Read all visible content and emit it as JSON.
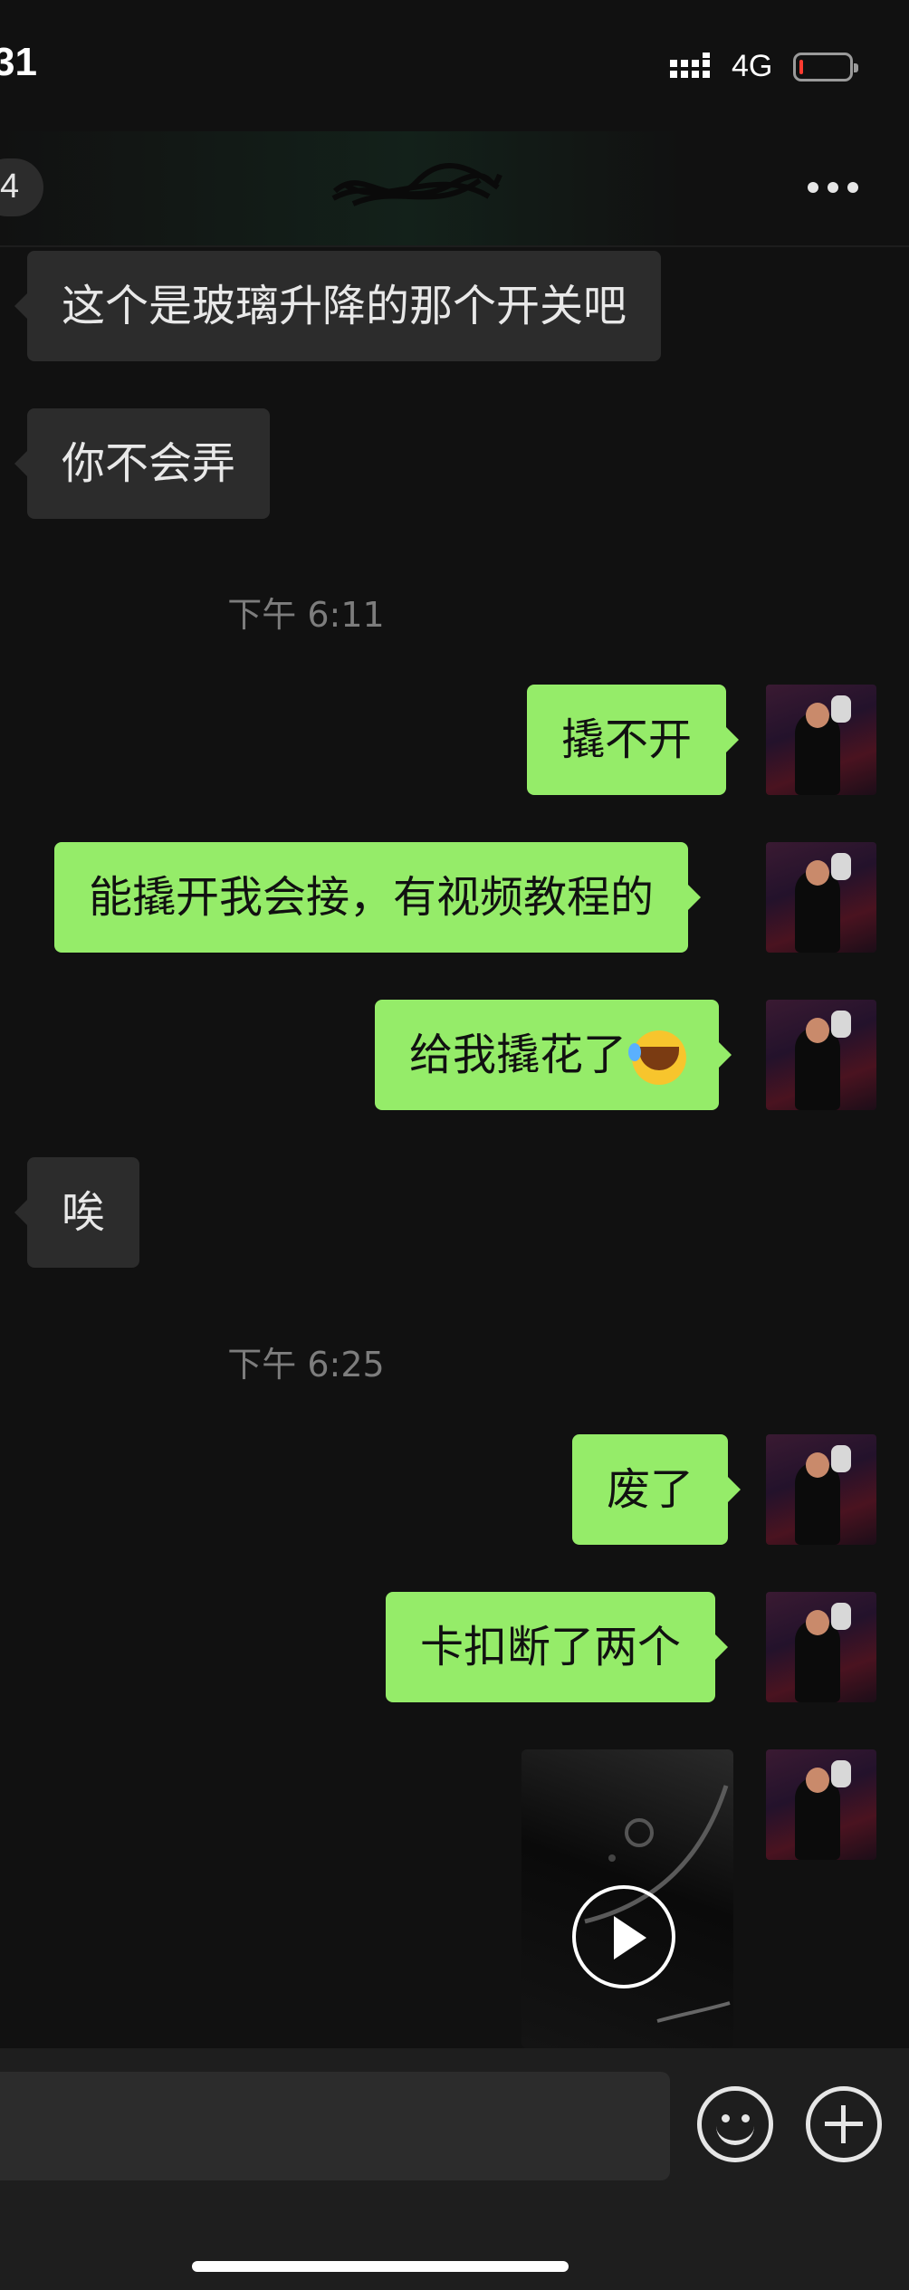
{
  "status_bar": {
    "time": "31",
    "network": "4G",
    "battery_level": "low"
  },
  "header": {
    "back_count": "4",
    "title": "",
    "more_icon": "ellipsis-icon"
  },
  "messages": [
    {
      "side": "in",
      "text": "这个是玻璃升降的那个开关吧"
    },
    {
      "side": "in",
      "text": "你不会弄"
    },
    {
      "type": "timestamp",
      "text": "下午 6:11"
    },
    {
      "side": "out",
      "text": "撬不开"
    },
    {
      "side": "out",
      "text": "能撬开我会接，有视频教程的"
    },
    {
      "side": "out",
      "text": "给我撬花了",
      "emoji": "laughing-crying-emoji"
    },
    {
      "side": "in",
      "text": "唉"
    },
    {
      "type": "timestamp",
      "text": "下午 6:25"
    },
    {
      "side": "out",
      "text": "废了"
    },
    {
      "side": "out",
      "text": "卡扣断了两个"
    },
    {
      "side": "out",
      "type": "video",
      "icon": "play-icon"
    }
  ],
  "input_bar": {
    "emoji_icon": "smiley-icon",
    "add_icon": "plus-icon"
  },
  "colors": {
    "outgoing_bubble": "#95ec69",
    "incoming_bubble": "#2c2c2c",
    "background": "#111111"
  }
}
